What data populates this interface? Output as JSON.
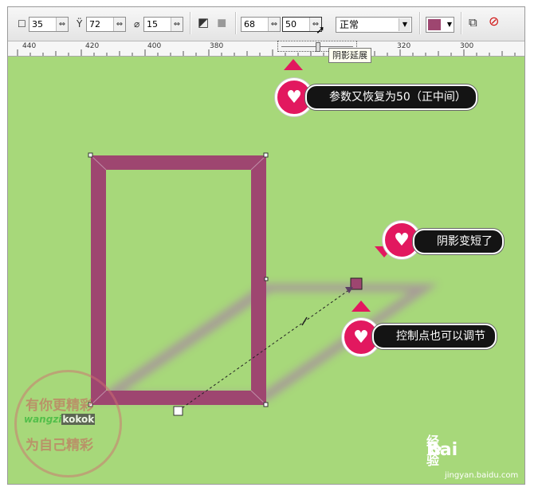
{
  "toolbar": {
    "field1": "35",
    "field2": "72",
    "field3": "15",
    "field4": "68",
    "field5": "50",
    "mode_select": "正常"
  },
  "ruler": {
    "ticks": [
      "440",
      "420",
      "400",
      "380",
      "320",
      "300"
    ]
  },
  "tooltip": "阴影延展",
  "callouts": {
    "c1": "参数又恢复为50（正中间）",
    "c2": "阴影变短了",
    "c3": "控制点也可以调节"
  },
  "watermark": {
    "line1": "有你更精彩",
    "line2": "wangzi",
    "line2b": "kokok",
    "line3": "为自己精彩"
  },
  "baidu": {
    "logo": "Bai",
    "logo2": "经验",
    "url": "jingyan.baidu.com"
  },
  "colors": {
    "canvas": "#a7d87a",
    "rect": "#9e4670",
    "shadow": "#a78aa0",
    "accent": "#e2185f"
  },
  "shadow_stretch_slider": 0.5
}
